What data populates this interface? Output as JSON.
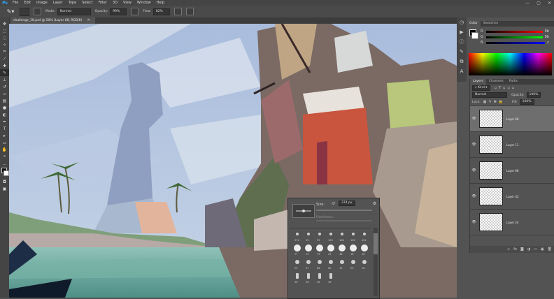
{
  "app": {
    "logo": "Ps"
  },
  "menu": [
    "File",
    "Edit",
    "Image",
    "Layer",
    "Type",
    "Select",
    "Filter",
    "3D",
    "View",
    "Window",
    "Help"
  ],
  "window_controls": [
    "—",
    "▢",
    "✕"
  ],
  "options_bar": {
    "mode_label": "Mode:",
    "mode_value": "Normal",
    "opacity_label": "Opacity:",
    "opacity_value": "99%",
    "flow_label": "Flow:",
    "flow_value": "82%"
  },
  "document": {
    "tab_title": "challenge_18.psd @ 50% (Layer 68, RGB/8)"
  },
  "color_panel": {
    "tabs": [
      "Color",
      "Swatches"
    ],
    "slider_labels": [
      "R",
      "G",
      "B"
    ],
    "slider_values": [
      "9b",
      "8b",
      "c"
    ]
  },
  "layers_panel": {
    "tabs": [
      "Layers",
      "Channels",
      "Paths"
    ],
    "kind_label": "Kind",
    "blend_mode": "Normal",
    "opacity_label": "Opacity:",
    "opacity_value": "100%",
    "lock_label": "Lock:",
    "fill_label": "Fill:",
    "fill_value": "100%",
    "layers": [
      {
        "name": "Layer 68",
        "selected": true
      },
      {
        "name": "Layer 11",
        "selected": false
      },
      {
        "name": "Layer 66",
        "selected": false
      },
      {
        "name": "Layer 42",
        "selected": false
      },
      {
        "name": "Layer 24",
        "selected": false
      }
    ],
    "footer_icons": [
      "link-icon",
      "fx-icon",
      "mask-icon",
      "adjustment-icon",
      "folder-icon",
      "new-layer-icon",
      "trash-icon"
    ]
  },
  "brush_panel": {
    "size_label": "Size:",
    "size_value": "374 px",
    "hardness_label": "Hardness:",
    "preset_numbers": [
      "374",
      "32",
      "95",
      "100",
      "108",
      "100",
      "101",
      "77",
      "25",
      "75",
      "25",
      "48",
      "18",
      "18",
      "25",
      "57",
      "88",
      "60",
      "15",
      "20",
      "18",
      "36",
      "36",
      "46",
      "38"
    ]
  },
  "colors": {
    "accent": "#31a8ff",
    "selected_layer": "#6e6e6e",
    "panel": "#535353"
  }
}
